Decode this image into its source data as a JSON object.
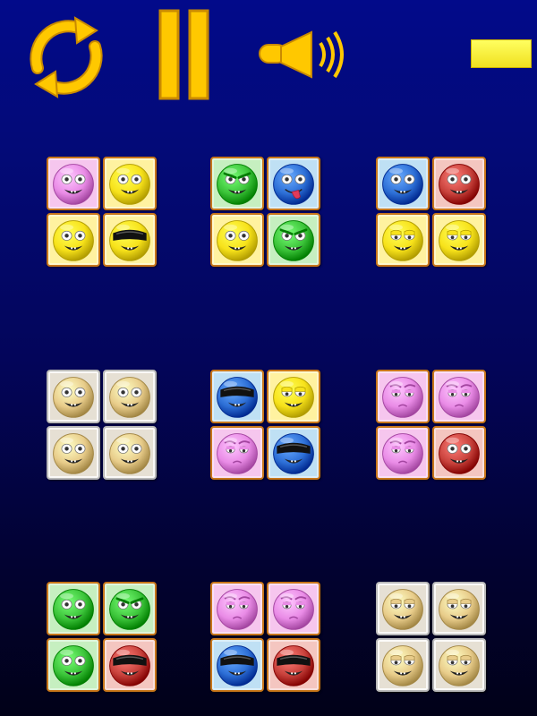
{
  "controls": {
    "accent": "#ffc800",
    "restart_icon": "restart-arrows-icon",
    "pause_icon": "pause-icon",
    "sound_icon": "speaker-sound-icon",
    "meter_color": "#ffff40"
  },
  "colors": {
    "pink": "#e98be6",
    "yellow": "#f7e21a",
    "green": "#3cc43a",
    "blue": "#2d6fd6",
    "red": "#c8423c",
    "faded": "#e8cc8a"
  },
  "tile_backgrounds": {
    "pink": "#f6c6ee",
    "yellow": "#fff2a0",
    "green": "#c6efc0",
    "blue": "#bfe0f4",
    "red": "#f4c6c0",
    "faded": "#e6e0d4"
  },
  "board": {
    "groups": [
      {
        "tiles": [
          {
            "color": "pink",
            "face": "eyes"
          },
          {
            "color": "yellow",
            "face": "eyes"
          },
          {
            "color": "yellow",
            "face": "eyes"
          },
          {
            "color": "yellow",
            "face": "sunglasses"
          }
        ]
      },
      {
        "tiles": [
          {
            "color": "green",
            "face": "angry"
          },
          {
            "color": "blue",
            "face": "tongue"
          },
          {
            "color": "yellow",
            "face": "eyes"
          },
          {
            "color": "green",
            "face": "angry"
          }
        ]
      },
      {
        "tiles": [
          {
            "color": "blue",
            "face": "eyes"
          },
          {
            "color": "red",
            "face": "eyes"
          },
          {
            "color": "yellow",
            "face": "sleepy"
          },
          {
            "color": "yellow",
            "face": "sleepy"
          }
        ]
      },
      {
        "tiles": [
          {
            "color": "faded",
            "face": "eyes"
          },
          {
            "color": "faded",
            "face": "eyes"
          },
          {
            "color": "faded",
            "face": "eyes"
          },
          {
            "color": "faded",
            "face": "eyes"
          }
        ]
      },
      {
        "tiles": [
          {
            "color": "blue",
            "face": "sunglasses"
          },
          {
            "color": "yellow",
            "face": "sleepy"
          },
          {
            "color": "pink",
            "face": "bored"
          },
          {
            "color": "blue",
            "face": "sunglasses"
          }
        ]
      },
      {
        "tiles": [
          {
            "color": "pink",
            "face": "bored"
          },
          {
            "color": "pink",
            "face": "bored"
          },
          {
            "color": "pink",
            "face": "bored"
          },
          {
            "color": "red",
            "face": "eyes"
          }
        ]
      },
      {
        "tiles": [
          {
            "color": "green",
            "face": "eyes"
          },
          {
            "color": "green",
            "face": "angry"
          },
          {
            "color": "green",
            "face": "eyes"
          },
          {
            "color": "red",
            "face": "sunglasses"
          }
        ]
      },
      {
        "tiles": [
          {
            "color": "pink",
            "face": "bored"
          },
          {
            "color": "pink",
            "face": "bored"
          },
          {
            "color": "blue",
            "face": "sunglasses"
          },
          {
            "color": "red",
            "face": "sunglasses"
          }
        ]
      },
      {
        "tiles": [
          {
            "color": "faded",
            "face": "sleepy"
          },
          {
            "color": "faded",
            "face": "sleepy"
          },
          {
            "color": "faded",
            "face": "sleepy"
          },
          {
            "color": "faded",
            "face": "sleepy"
          }
        ]
      }
    ]
  }
}
